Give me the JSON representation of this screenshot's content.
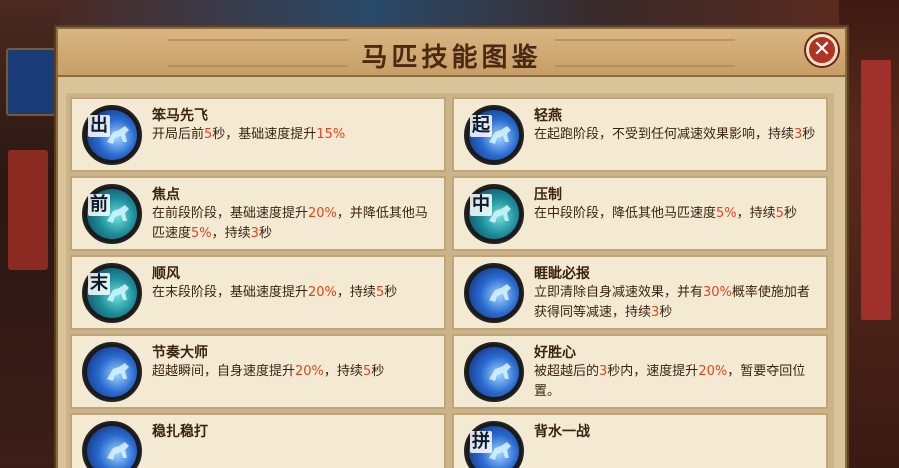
{
  "title": "马匹技能图鉴",
  "close_label": "✕",
  "skills": [
    {
      "name": "笨马先飞",
      "glyph": "出",
      "icon": "teal-horse-icon",
      "theme": "blue",
      "desc": [
        [
          "开局后前",
          0
        ],
        [
          "5",
          1
        ],
        [
          "秒，基础速度提升",
          0
        ],
        [
          "15%",
          1
        ]
      ]
    },
    {
      "name": "轻燕",
      "glyph": "起",
      "icon": "teal-horse-icon",
      "theme": "blue",
      "desc": [
        [
          "在起跑阶段，不受到任何减速效果影响，持续",
          0
        ],
        [
          "3",
          1
        ],
        [
          "秒",
          0
        ]
      ]
    },
    {
      "name": "焦点",
      "glyph": "前",
      "icon": "teal-horse-icon",
      "theme": "teal",
      "desc": [
        [
          "在前段阶段，基础速度提升",
          0
        ],
        [
          "20%",
          1
        ],
        [
          "，并降低其他马匹速度",
          0
        ],
        [
          "5%",
          1
        ],
        [
          "，持续",
          0
        ],
        [
          "3",
          1
        ],
        [
          "秒",
          0
        ]
      ]
    },
    {
      "name": "压制",
      "glyph": "中",
      "icon": "teal-horse-icon",
      "theme": "teal",
      "desc": [
        [
          "在中段阶段，降低其他马匹速度",
          0
        ],
        [
          "5%",
          1
        ],
        [
          "，持续",
          0
        ],
        [
          "5",
          1
        ],
        [
          "秒",
          0
        ]
      ]
    },
    {
      "name": "顺风",
      "glyph": "末",
      "icon": "teal-horse-icon",
      "theme": "teal",
      "desc": [
        [
          "在末段阶段，基础速度提升",
          0
        ],
        [
          "20%",
          1
        ],
        [
          "，持续",
          0
        ],
        [
          "5",
          1
        ],
        [
          "秒",
          0
        ]
      ]
    },
    {
      "name": "睚眦必报",
      "glyph": "",
      "icon": "blade-icon",
      "theme": "blue",
      "desc": [
        [
          "立即清除自身减速效果，并有",
          0
        ],
        [
          "30%",
          1
        ],
        [
          "概率使施加者获得同等减速，持续",
          0
        ],
        [
          "3",
          1
        ],
        [
          "秒",
          0
        ]
      ]
    },
    {
      "name": "节奏大师",
      "glyph": "",
      "icon": "cloud-horse-icon",
      "theme": "blue",
      "desc": [
        [
          "超越瞬间，自身速度提升",
          0
        ],
        [
          "20%",
          1
        ],
        [
          "，持续",
          0
        ],
        [
          "5",
          1
        ],
        [
          "秒",
          0
        ]
      ]
    },
    {
      "name": "好胜心",
      "glyph": "",
      "icon": "rearing-horse-icon",
      "theme": "blue",
      "desc": [
        [
          "被超越后的",
          0
        ],
        [
          "3",
          1
        ],
        [
          "秒内，速度提升",
          0
        ],
        [
          "20%",
          1
        ],
        [
          "，暂要夺回位置。",
          0
        ]
      ]
    },
    {
      "name": "稳扎稳打",
      "glyph": "",
      "icon": "horse-icon",
      "theme": "blue",
      "desc": []
    },
    {
      "name": "背水一战",
      "glyph": "拼",
      "icon": "horse-icon",
      "theme": "blue",
      "desc": []
    }
  ]
}
